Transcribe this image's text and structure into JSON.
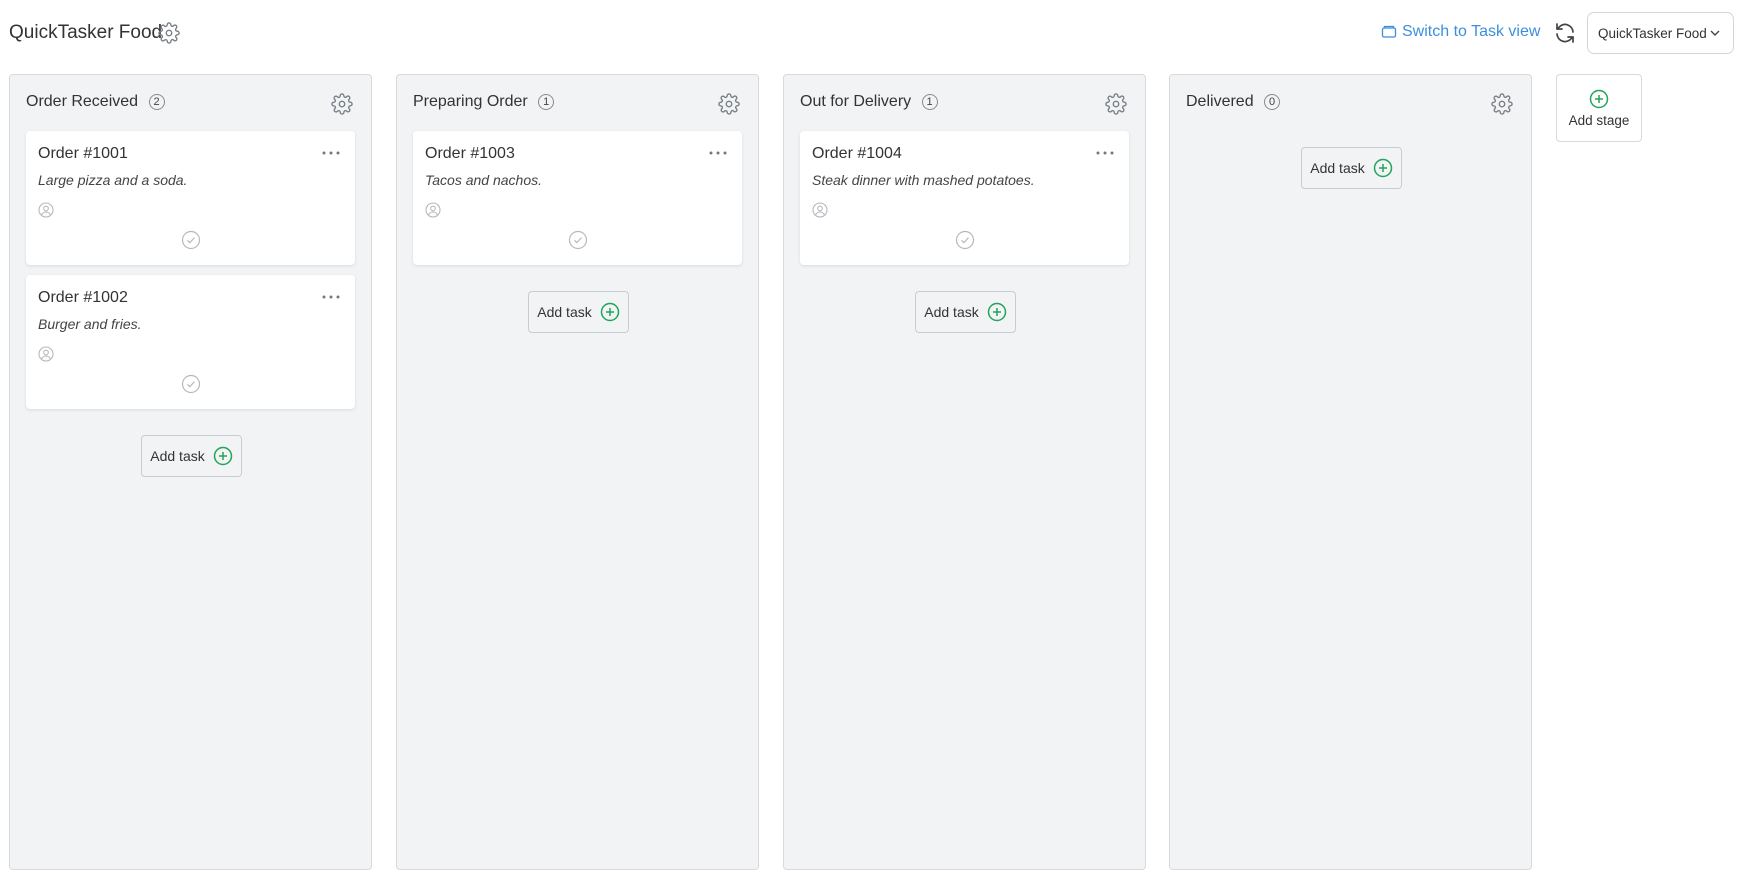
{
  "header": {
    "project_title": "QuickTasker Food",
    "switch_view_label": "Switch to Task view",
    "project_select_value": "QuickTasker Food"
  },
  "stages": [
    {
      "name": "Order Received",
      "count": "2",
      "tasks": [
        {
          "title": "Order #1001",
          "description": "Large pizza and a soda."
        },
        {
          "title": "Order #1002",
          "description": "Burger and fries."
        }
      ],
      "add_task_label": "Add task"
    },
    {
      "name": "Preparing Order",
      "count": "1",
      "tasks": [
        {
          "title": "Order #1003",
          "description": "Tacos and nachos."
        }
      ],
      "add_task_label": "Add task"
    },
    {
      "name": "Out for Delivery",
      "count": "1",
      "tasks": [
        {
          "title": "Order #1004",
          "description": "Steak dinner with mashed potatoes."
        }
      ],
      "add_task_label": "Add task"
    },
    {
      "name": "Delivered",
      "count": "0",
      "tasks": [],
      "add_task_label": "Add task"
    }
  ],
  "add_stage_label": "Add stage",
  "colors": {
    "link_blue": "#3d8fdc",
    "add_green": "#22a559",
    "stage_bg": "#f2f3f5",
    "icon_gray": "#9aa0a6"
  },
  "icons": {
    "settings": "gear-icon",
    "switch_view": "task-view-icon",
    "refresh": "refresh-icon",
    "dropdown": "chevron-down-icon",
    "card_menu": "more-horizontal-icon",
    "assignee": "user-circle-icon",
    "complete": "check-circle-icon",
    "add": "plus-circle-icon"
  }
}
